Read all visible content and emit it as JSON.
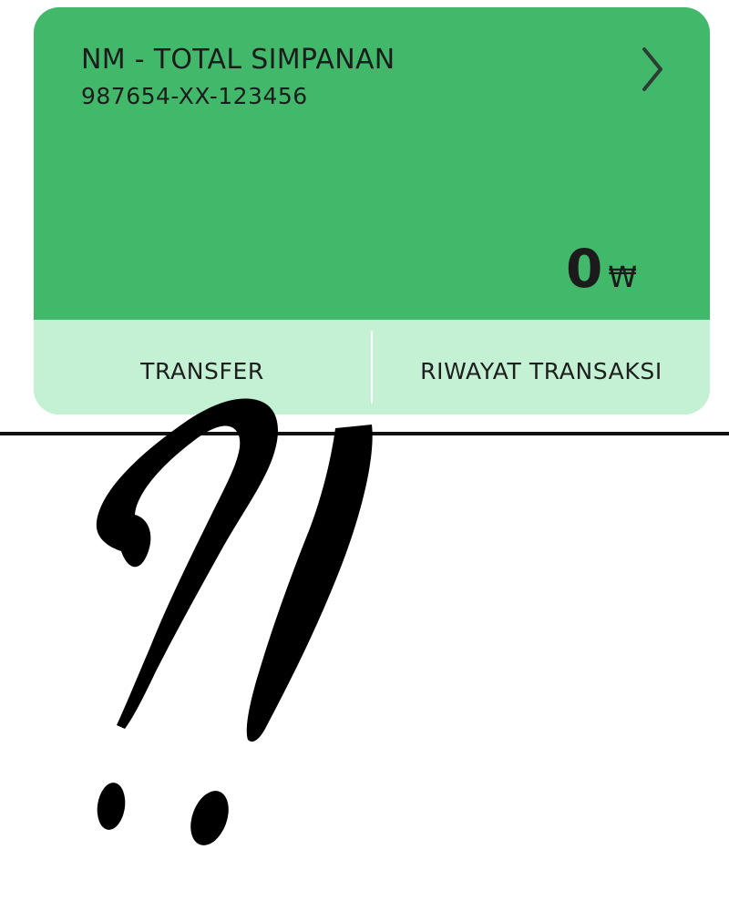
{
  "account_card": {
    "name": "NM - TOTAL SIMPANAN",
    "number": "987654-XX-123456",
    "balance": "0",
    "currency_symbol": "₩",
    "chevron_icon": "chevron-right-icon",
    "colors": {
      "card_green": "#42b96a",
      "action_bar": "#c4f0d4",
      "text": "#1c1c1c"
    }
  },
  "actions": {
    "transfer_label": "TRANSFER",
    "history_label": "RIWAYAT TRANSAKSI"
  },
  "overlay": {
    "icon": "brush-stroke-question-exclamation-icon",
    "color": "#000000"
  }
}
